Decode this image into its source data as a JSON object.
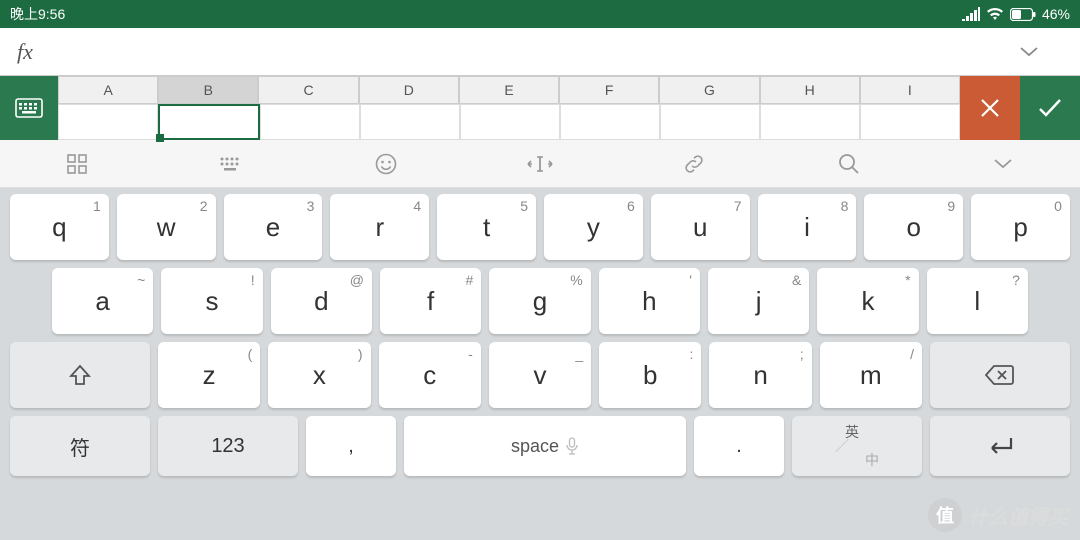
{
  "status": {
    "time": "晚上9:56",
    "battery": "46%"
  },
  "formula": {
    "fx": "fx",
    "value": ""
  },
  "columns": [
    "A",
    "B",
    "C",
    "D",
    "E",
    "F",
    "G",
    "H",
    "I"
  ],
  "active_col": "B",
  "keyboard": {
    "row1": [
      {
        "k": "q",
        "s": "1"
      },
      {
        "k": "w",
        "s": "2"
      },
      {
        "k": "e",
        "s": "3"
      },
      {
        "k": "r",
        "s": "4"
      },
      {
        "k": "t",
        "s": "5"
      },
      {
        "k": "y",
        "s": "6"
      },
      {
        "k": "u",
        "s": "7"
      },
      {
        "k": "i",
        "s": "8"
      },
      {
        "k": "o",
        "s": "9"
      },
      {
        "k": "p",
        "s": "0"
      }
    ],
    "row2": [
      {
        "k": "a",
        "s": "~"
      },
      {
        "k": "s",
        "s": "!"
      },
      {
        "k": "d",
        "s": "@"
      },
      {
        "k": "f",
        "s": "#"
      },
      {
        "k": "g",
        "s": "%"
      },
      {
        "k": "h",
        "s": "'"
      },
      {
        "k": "j",
        "s": "&"
      },
      {
        "k": "k",
        "s": "*"
      },
      {
        "k": "l",
        "s": "?"
      }
    ],
    "row3": [
      {
        "k": "z",
        "s": "("
      },
      {
        "k": "x",
        "s": ")"
      },
      {
        "k": "c",
        "s": "-"
      },
      {
        "k": "v",
        "s": "_"
      },
      {
        "k": "b",
        "s": ":"
      },
      {
        "k": "n",
        "s": ";"
      },
      {
        "k": "m",
        "s": "/"
      }
    ],
    "row4": {
      "sym": "符",
      "num": "123",
      "comma": ",",
      "space": "space",
      "period": ".",
      "lang_top": "英",
      "lang_bot": "中"
    }
  },
  "watermark": {
    "icon": "值",
    "text": "什么值得买"
  }
}
